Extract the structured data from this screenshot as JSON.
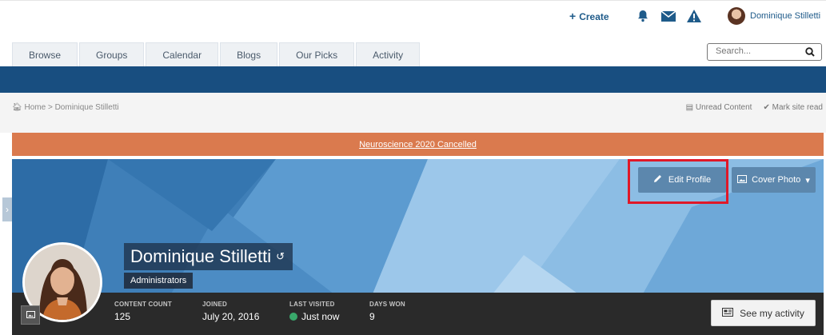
{
  "header": {
    "create_label": "Create",
    "user_name": "Dominique Stilletti"
  },
  "nav": {
    "tabs": [
      "Browse",
      "Groups",
      "Calendar",
      "Blogs",
      "Our Picks",
      "Activity"
    ]
  },
  "search": {
    "placeholder": "Search..."
  },
  "breadcrumb": {
    "home": "Home",
    "separator": ">",
    "current": "Dominique Stilletti",
    "unread": "Unread Content",
    "mark_read": "Mark site read"
  },
  "announcement": {
    "text": "Neuroscience 2020 Cancelled"
  },
  "profile": {
    "edit_label": "Edit Profile",
    "cover_label": "Cover Photo",
    "name": "Dominique Stilletti",
    "group": "Administrators",
    "activity_label": "See my activity"
  },
  "stats": {
    "content_count_label": "CONTENT COUNT",
    "content_count": "125",
    "joined_label": "JOINED",
    "joined": "July 20, 2016",
    "last_visited_label": "LAST VISITED",
    "last_visited": "Just now",
    "days_won_label": "DAYS WON",
    "days_won": "9"
  },
  "colors": {
    "brand_blue": "#184e80",
    "announcement": "#da7a4e",
    "button": "#5c87ad",
    "online": "#39a86b",
    "highlight": "#e01828"
  }
}
